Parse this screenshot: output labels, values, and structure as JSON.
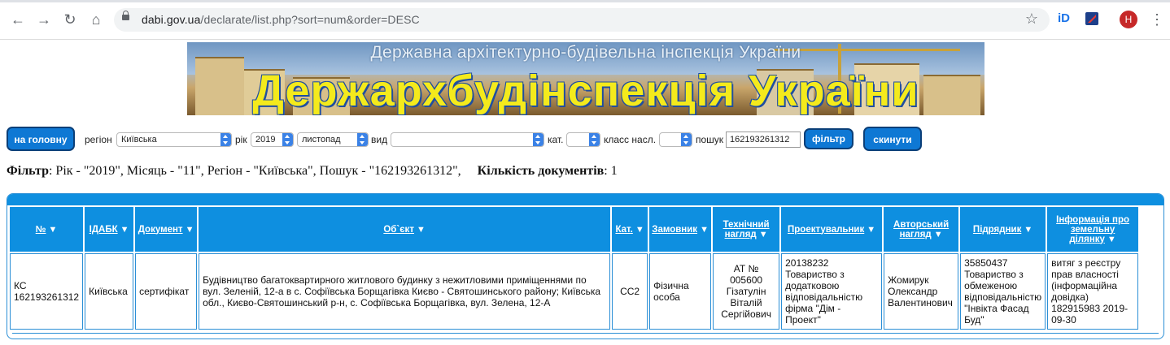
{
  "browser": {
    "url_host": "dabi.gov.ua",
    "url_path": "/declarate/list.php?sort=num&order=DESC",
    "avatar_letter": "Н",
    "ext1_label": "iD"
  },
  "banner": {
    "subtitle": "Державна архітектурно-будівельна інспекція України",
    "title": "Держархбудінспекція України"
  },
  "filters": {
    "home_button": "на головну",
    "region_label": "регіон",
    "region_value": "Київська",
    "year_label": "рік",
    "year_value": "2019",
    "month_value": "листопад",
    "type_label": "вид",
    "type_value": "",
    "cat_label": "кат.",
    "cat_value": "",
    "class_label": "класс насл.",
    "class_value": "",
    "search_label": "пошук",
    "search_value": "162193261312",
    "filter_button": "фільтр",
    "reset_button": "скинути"
  },
  "summary": {
    "filter_label": "Фільтр",
    "filter_text": ": Рік - \"2019\", Місяць - \"11\", Регіон - \"Київська\", Пошук - \"162193261312\",",
    "count_label": "Кількість документів",
    "count_value": ": 1"
  },
  "table": {
    "headers": [
      "№",
      "ІДАБК",
      "Документ",
      "Об`єкт",
      "Кат.",
      "Замовник",
      "Технічний нагляд",
      "Проектувальник",
      "Авторський нагляд",
      "Підрядник",
      "Інформація про земельну ділянку"
    ],
    "rows": [
      [
        "КС 162193261312",
        "Київська",
        "сертифікат",
        "Будівництво багатоквартирного житлового будинку з нежитловими приміщеннями по вул. Зеленій, 12-а в с. Софіївська Борщагівка Києво - Святошинського району; Київська обл., Києво-Святошинський р-н, с. Софіївська Борщагівка, вул. Зелена, 12-А",
        "СС2",
        "Фізична особа",
        "АТ № 005600 Гізатулін Віталій Сергійович",
        "20138232 Товариство з додатковою відповідальністю фірма \"Дім - Проект\"",
        "Жомирук Олександр Валентинович",
        "35850437 Товариство з обмеженою відповідальністю \"Інвікта Фасад Буд\"",
        "витяг з реєстру прав власності (інформаційна довідка) 182915983 2019-09-30"
      ]
    ]
  }
}
